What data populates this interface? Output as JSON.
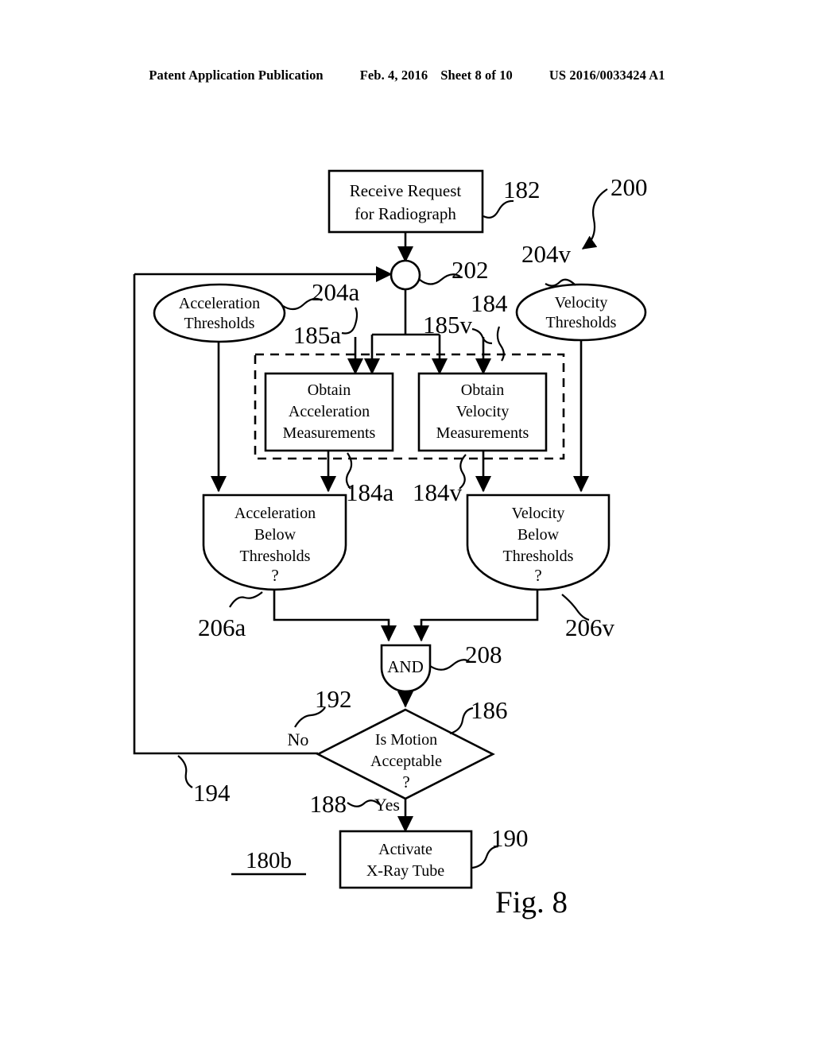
{
  "header": {
    "publication": "Patent Application Publication",
    "date": "Feb. 4, 2016",
    "sheet": "Sheet 8 of 10",
    "number": "US 2016/0033424 A1"
  },
  "figure": {
    "label": "Fig. 8",
    "diagram_tag": "180b",
    "nodes": {
      "receive_request": {
        "line1": "Receive Request",
        "line2": "for Radiograph",
        "ref": "182"
      },
      "junction": {
        "ref": "202"
      },
      "accel_thresholds": {
        "line1": "Acceleration",
        "line2": "Thresholds",
        "ref": "204a"
      },
      "velocity_thresholds": {
        "line1": "Velocity",
        "line2": "Thresholds",
        "ref": "204v"
      },
      "obtain_accel": {
        "line1": "Obtain",
        "line2": "Acceleration",
        "line3": "Measurements",
        "ref": "184a"
      },
      "obtain_velocity": {
        "line1": "Obtain",
        "line2": "Velocity",
        "line3": "Measurements",
        "ref": "184v"
      },
      "measurement_group": {
        "ref": "184"
      },
      "accel_feed": {
        "ref": "185a"
      },
      "velocity_feed": {
        "ref": "185v"
      },
      "accel_below": {
        "line1": "Acceleration",
        "line2": "Below",
        "line3": "Thresholds",
        "line4": "?",
        "ref": "206a"
      },
      "velocity_below": {
        "line1": "Velocity",
        "line2": "Below",
        "line3": "Thresholds",
        "line4": "?",
        "ref": "206v"
      },
      "and_gate": {
        "label": "AND",
        "ref": "208"
      },
      "is_motion_acceptable": {
        "line1": "Is Motion",
        "line2": "Acceptable",
        "line3": "?",
        "ref": "186"
      },
      "activate_tube": {
        "line1": "Activate",
        "line2": "X-Ray Tube",
        "ref": "190"
      },
      "overall_system": {
        "ref": "200"
      }
    },
    "branches": {
      "no": {
        "label": "No",
        "ref": "192"
      },
      "yes": {
        "label": "Yes",
        "ref": "188"
      },
      "feedback": {
        "ref": "194"
      }
    }
  }
}
